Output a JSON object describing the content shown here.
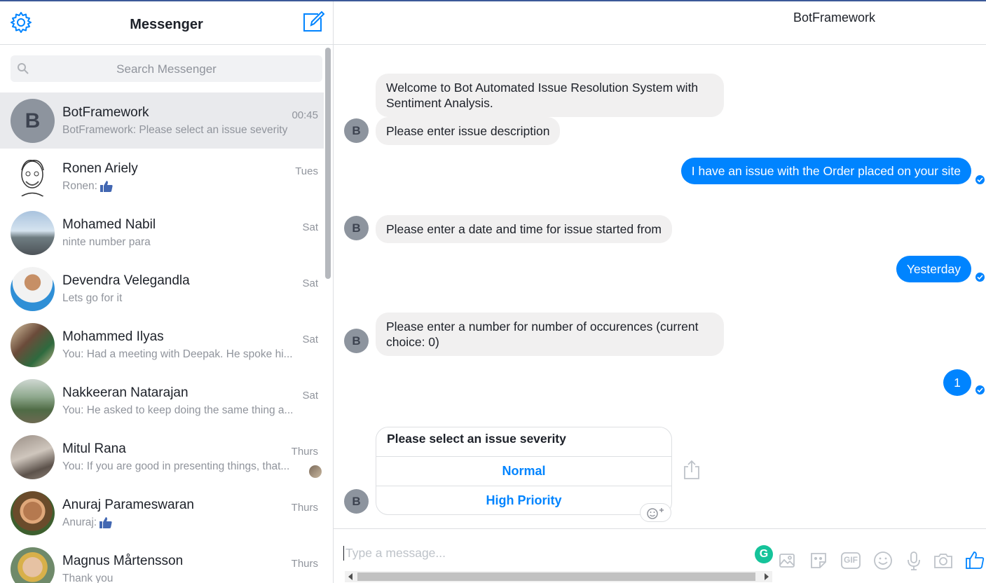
{
  "sidebar": {
    "title": "Messenger",
    "search_placeholder": "Search Messenger",
    "conversations": [
      {
        "name": "BotFramework",
        "snippet": "BotFramework: Please select an issue severity",
        "time": "00:45",
        "avatar_letter": "B"
      },
      {
        "name": "Ronen Ariely",
        "snippet": "Ronen:",
        "time": "Tues"
      },
      {
        "name": "Mohamed Nabil",
        "snippet": "ninte number para",
        "time": "Sat"
      },
      {
        "name": "Devendra Velegandla",
        "snippet": "Lets go for it",
        "time": "Sat"
      },
      {
        "name": "Mohammed Ilyas",
        "snippet": "You: Had a meeting with Deepak. He spoke hi...",
        "time": "Sat"
      },
      {
        "name": "Nakkeeran Natarajan",
        "snippet": "You: He asked to keep doing the same thing a...",
        "time": "Sat"
      },
      {
        "name": "Mitul Rana",
        "snippet": "You: If you are good in presenting things, that...",
        "time": "Thurs"
      },
      {
        "name": "Anuraj Parameswaran",
        "snippet": "Anuraj:",
        "time": "Thurs"
      },
      {
        "name": "Magnus Mårtensson",
        "snippet": "Thank you",
        "time": "Thurs"
      }
    ]
  },
  "chat": {
    "title": "BotFramework",
    "bot_letter": "B",
    "messages": {
      "welcome": "Welcome to Bot Automated Issue Resolution System with Sentiment Analysis.",
      "ask_description": "Please enter issue description",
      "reply_description": "I have an issue with the Order placed on your site",
      "ask_date": "Please enter a date and time for issue started from",
      "reply_date": "Yesterday",
      "ask_occurrences": "Please enter a number for number of occurences (current choice: 0)",
      "reply_occurrences": "1"
    },
    "card": {
      "title": "Please select an issue severity",
      "options": [
        "Normal",
        "High Priority"
      ]
    },
    "composer_placeholder": "Type a message...",
    "grammarly_letter": "G",
    "gif_label": "GIF"
  },
  "colors": {
    "accent": "#0084ff",
    "incoming_bubble": "#f1f0f0",
    "muted_text": "#90949c",
    "topline": "#3b5998"
  }
}
